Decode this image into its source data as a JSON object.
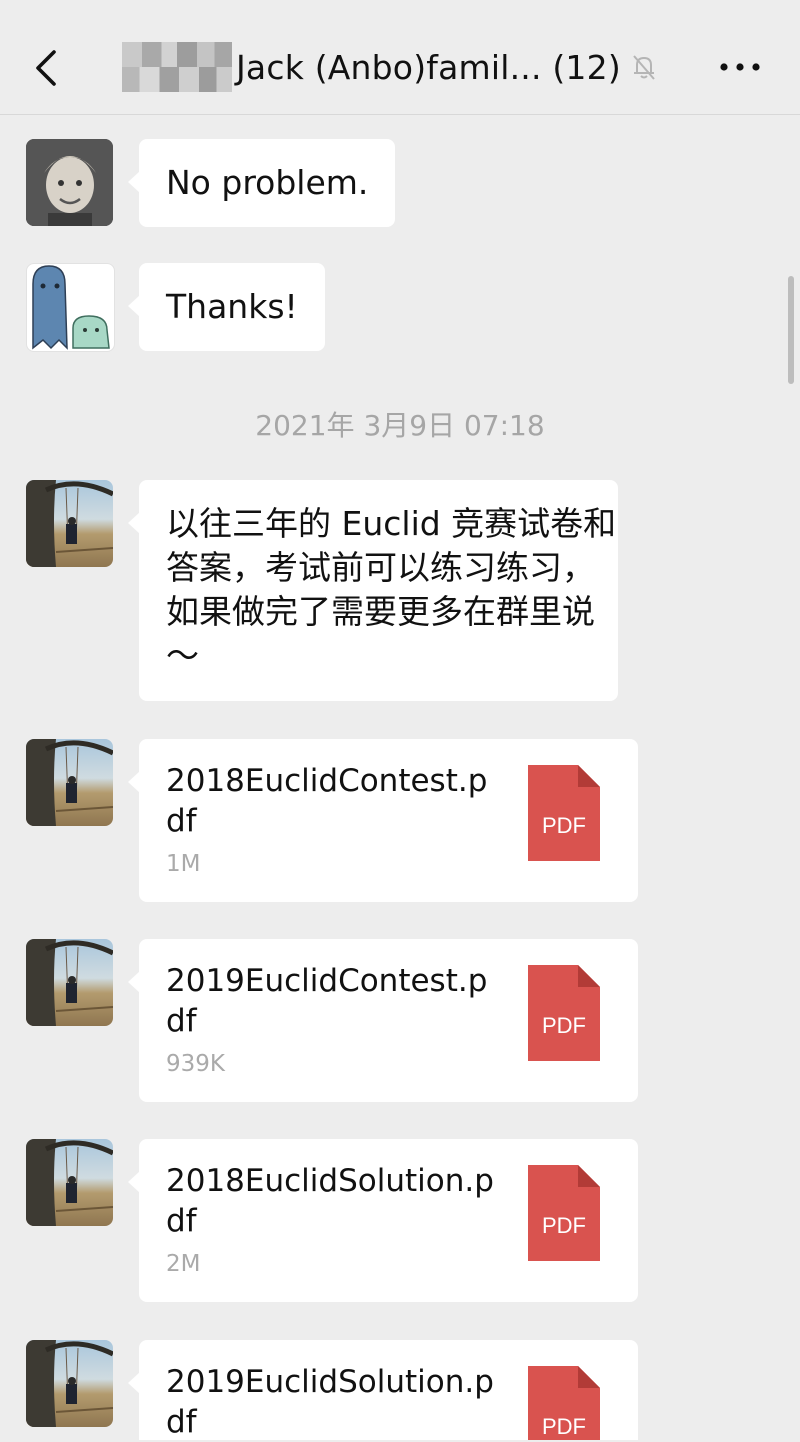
{
  "header": {
    "title": "Jack (Anbo)famil... (12)",
    "back_icon": "chevron-left-icon",
    "mute_icon": "bell-off-icon",
    "more_icon": "more-dots-icon"
  },
  "messages": [
    {
      "type": "text",
      "text": "No problem.",
      "avatar": "avatar-boy"
    },
    {
      "type": "text",
      "text": "Thanks!",
      "avatar": "avatar-ghost"
    }
  ],
  "timestamp": "2021年 3月9日 07:18",
  "long_message": {
    "lines": [
      "以往三年的 Euclid 竞赛试卷和",
      "答案，考试前可以练习练习，",
      "如果做完了需要更多在群里说",
      "～"
    ]
  },
  "files": [
    {
      "name": "2018EuclidContest.pdf",
      "size": "1M",
      "icon": "PDF"
    },
    {
      "name": "2019EuclidContest.pdf",
      "size": "939K",
      "icon": "PDF"
    },
    {
      "name": "2018EuclidSolution.pdf",
      "size": "2M",
      "icon": "PDF"
    },
    {
      "name": "2019EuclidSolution.pdf",
      "size": "",
      "icon": "PDF"
    }
  ],
  "colors": {
    "background": "#ededed",
    "pdf": "#d9534f",
    "bubble": "#ffffff"
  }
}
